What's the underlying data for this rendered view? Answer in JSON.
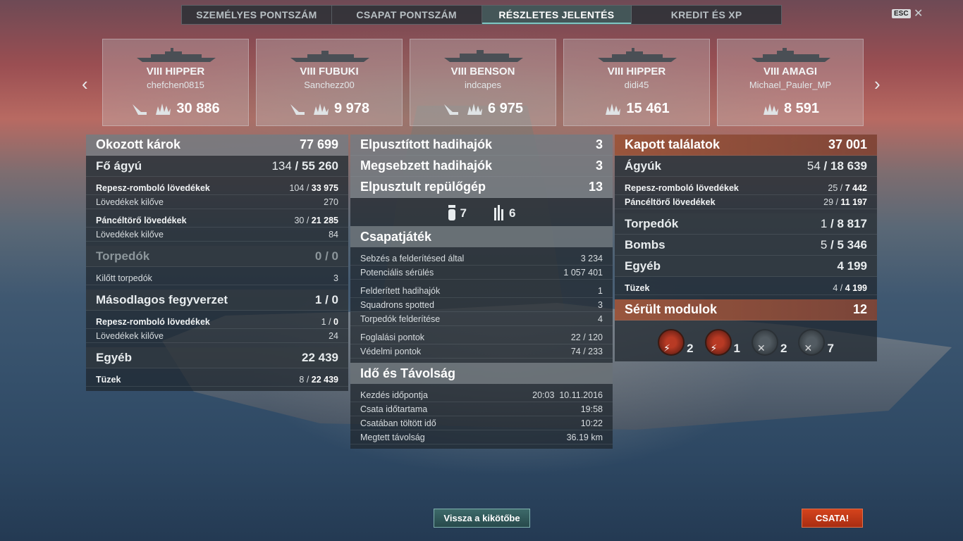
{
  "tabs": [
    {
      "label": "SZEMÉLYES PONTSZÁM",
      "active": false
    },
    {
      "label": "CSAPAT PONTSZÁM",
      "active": false
    },
    {
      "label": "RÉSZLETES JELENTÉS",
      "active": true
    },
    {
      "label": "KREDIT ÉS XP",
      "active": false
    }
  ],
  "esc_label": "ESC",
  "close_glyph": "✕",
  "nav": {
    "prev": "‹",
    "next": "›"
  },
  "cards": [
    {
      "ship": "VIII HIPPER",
      "player": "chefchen0815",
      "damage": "30 886",
      "icons": [
        "torpedo-hit-icon",
        "explosion-icon"
      ]
    },
    {
      "ship": "VIII FUBUKI",
      "player": "Sanchezz00",
      "damage": "9 978",
      "icons": [
        "torpedo-hit-icon",
        "explosion-icon"
      ]
    },
    {
      "ship": "VIII BENSON",
      "player": "indcapes",
      "damage": "6 975",
      "icons": [
        "torpedo-hit-icon",
        "explosion-icon"
      ]
    },
    {
      "ship": "VIII HIPPER",
      "player": "didi45",
      "damage": "15 461",
      "icons": [
        "explosion-icon"
      ]
    },
    {
      "ship": "VIII AMAGI",
      "player": "Michael_Pauler_MP",
      "damage": "8 591",
      "icons": [
        "explosion-icon"
      ]
    }
  ],
  "left": {
    "caused_damage": {
      "label": "Okozott károk",
      "value": "77 699"
    },
    "main_guns": {
      "label": "Fő ágyú",
      "hits": "134",
      "total": "55 260"
    },
    "he_label": "Repesz-romboló lövedékek",
    "he_hits": "104",
    "he_total": "33 975",
    "he_fired_label": "Lövedékek kilőve",
    "he_fired": "270",
    "ap_label": "Páncéltörő lövedékek",
    "ap_hits": "30",
    "ap_total": "21 285",
    "ap_fired_label": "Lövedékek kilőve",
    "ap_fired": "84",
    "torpedoes": {
      "label": "Torpedók",
      "value": "0 / 0"
    },
    "torp_fired_label": "Kilőtt torpedók",
    "torp_fired": "3",
    "secondary": {
      "label": "Másodlagos fegyverzet",
      "value": "1 / 0"
    },
    "sec_he_label": "Repesz-romboló lövedékek",
    "sec_he_hits": "1",
    "sec_he_total": "0",
    "sec_fired_label": "Lövedékek kilőve",
    "sec_fired": "24",
    "other": {
      "label": "Egyéb",
      "value": "22 439"
    },
    "fires_label": "Tüzek",
    "fires_hits": "8",
    "fires_total": "22 439"
  },
  "middle": {
    "destroyed_ships": {
      "label": "Elpusztított hadihajók",
      "value": "3"
    },
    "damaged_ships": {
      "label": "Megsebzett hadihajók",
      "value": "3"
    },
    "destroyed_planes": {
      "label": "Elpusztult repülőgép",
      "value": "13"
    },
    "consumable1": "7",
    "consumable2": "6",
    "teamwork": "Csapatjáték",
    "spot_damage_label": "Sebzés a felderítésed által",
    "spot_damage": "3 234",
    "potential_label": "Potenciális sérülés",
    "potential": "1 057 401",
    "spotted_ships_label": "Felderített hadihajók",
    "spotted_ships": "1",
    "squadrons_label": "Squadrons spotted",
    "squadrons": "3",
    "torp_spot_label": "Torpedók felderítése",
    "torp_spot": "4",
    "capture_label": "Foglalási pontok",
    "capture": "22 / 120",
    "defense_label": "Védelmi pontok",
    "defense": "74 / 233",
    "time_title": "Idő és Távolság",
    "start_label": "Kezdés időpontja",
    "start": "20:03  10.11.2016",
    "duration_label": "Csata időtartama",
    "duration": "19:58",
    "time_in_label": "Csatában töltött idő",
    "time_in": "10:22",
    "distance_label": "Megtett távolság",
    "distance": "36.19 km"
  },
  "right": {
    "received": {
      "label": "Kapott találatok",
      "value": "37 001"
    },
    "guns": {
      "label": "Ágyúk",
      "hits": "54",
      "total": "18 639"
    },
    "he_label": "Repesz-romboló lövedékek",
    "he_hits": "25",
    "he_total": "7 442",
    "ap_label": "Páncéltörő lövedékek",
    "ap_hits": "29",
    "ap_total": "11 197",
    "torpedoes": {
      "label": "Torpedók",
      "hits": "1",
      "total": "8 817"
    },
    "bombs": {
      "label": "Bombs",
      "hits": "5",
      "total": "5 346"
    },
    "other": {
      "label": "Egyéb",
      "value": "4 199"
    },
    "fires_label": "Tüzek",
    "fires_hits": "4",
    "fires_total": "4 199",
    "modules": {
      "label": "Sérült modulok",
      "value": "12"
    },
    "mod_counts": [
      "2",
      "1",
      "2",
      "7"
    ]
  },
  "buttons": {
    "back": "Vissza a kikötőbe",
    "battle": "CSATA!"
  },
  "colors": {
    "accent": "#7fc6c2",
    "orange": "#d5431c",
    "received_header": "#aa5a3c"
  }
}
